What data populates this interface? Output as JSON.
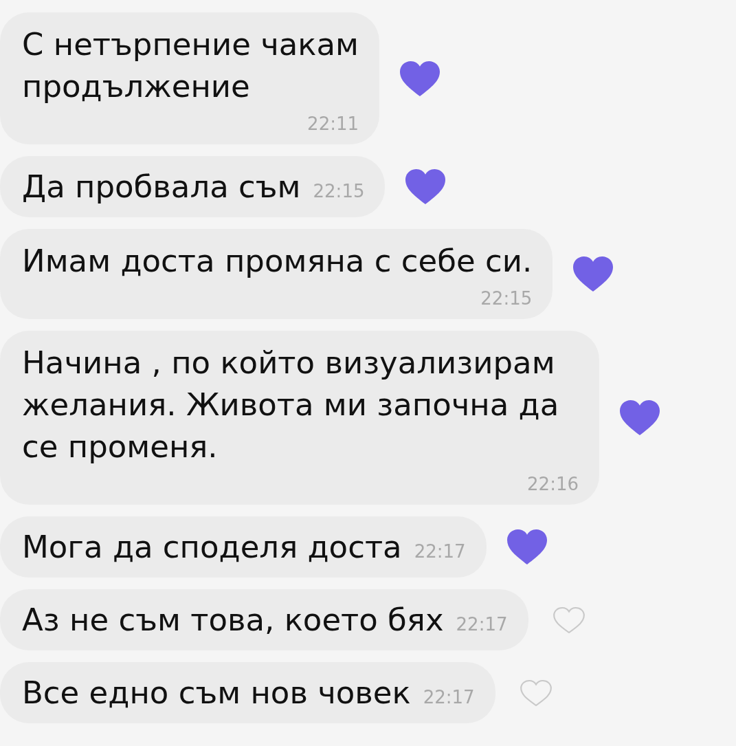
{
  "messages": [
    {
      "kind": "stacked",
      "text": "С нетърпение чакам\nпродължение",
      "time": "22:11",
      "liked": true
    },
    {
      "kind": "compact",
      "text": "Да пробвала съм",
      "time": "22:15",
      "liked": true
    },
    {
      "kind": "stacked",
      "text": "Имам доста промяна с себе си.",
      "time": "22:15",
      "liked": true
    },
    {
      "kind": "stacked",
      "text": "Начина , по който визуализирам желания. Живота ми започна да се променя.",
      "time": "22:16",
      "liked": true
    },
    {
      "kind": "compact",
      "text": "Мога да споделя доста",
      "time": "22:17",
      "liked": true
    },
    {
      "kind": "compact",
      "text": "Аз не съм това, което бях",
      "time": "22:17",
      "liked": false
    },
    {
      "kind": "compact",
      "text": "Все едно съм нов човек",
      "time": "22:17",
      "liked": false
    }
  ]
}
